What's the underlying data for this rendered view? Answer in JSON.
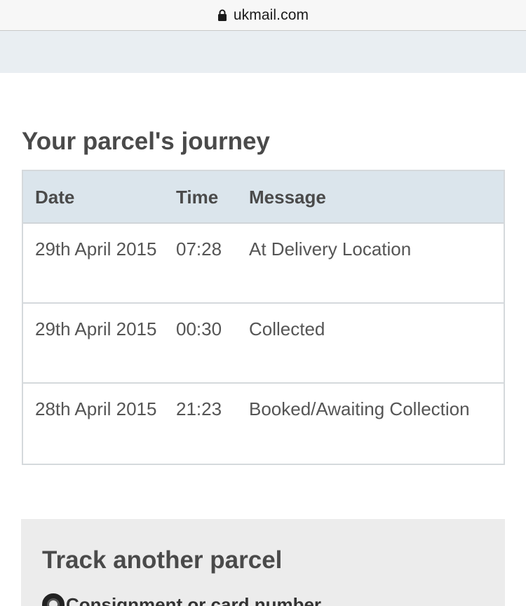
{
  "browser": {
    "url": "ukmail.com"
  },
  "journey": {
    "title": "Your parcel's journey",
    "columns": {
      "date": "Date",
      "time": "Time",
      "message": "Message"
    },
    "rows": [
      {
        "date": "29th April 2015",
        "time": "07:28",
        "message": "At Delivery Location"
      },
      {
        "date": "29th April 2015",
        "time": "00:30",
        "message": "Collected"
      },
      {
        "date": "28th April 2015",
        "time": "21:23",
        "message": "Booked/Awaiting Collection"
      }
    ]
  },
  "track": {
    "title": "Track another parcel",
    "option_label": "Consignment or card number"
  },
  "colors": {
    "header_bg": "#dbe5ec",
    "panel_bg": "#ececec",
    "subbar_bg": "#e9eef2"
  },
  "icons": {
    "lock": "lock-icon"
  }
}
